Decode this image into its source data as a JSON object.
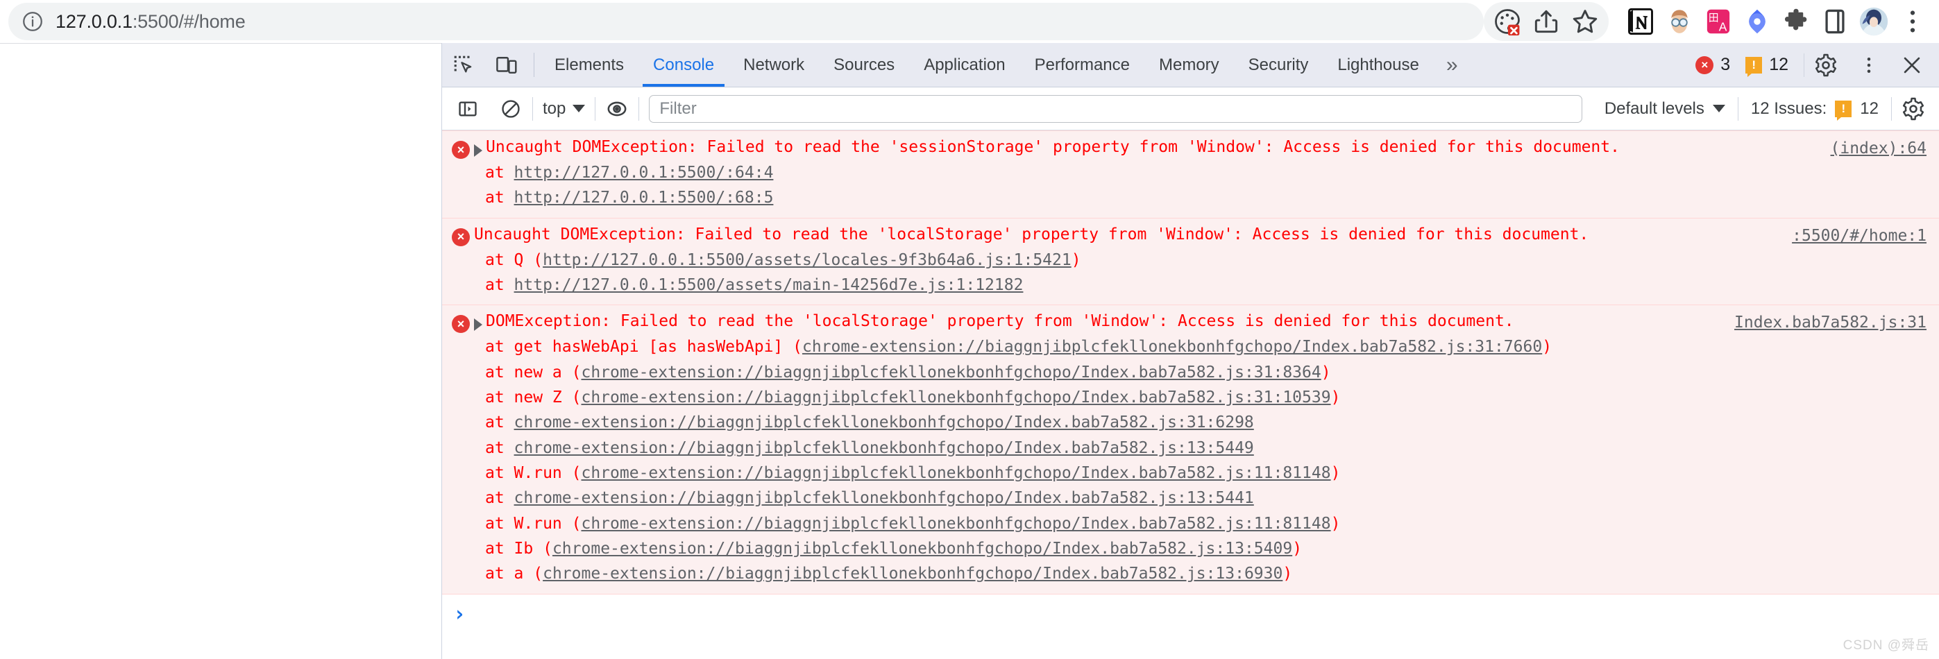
{
  "browser": {
    "site_info_icon": "info-circle-icon",
    "url_full": "127.0.0.1:5500/#/home",
    "url_host": "127.0.0.1",
    "url_rest": ":5500/#/home",
    "actions": [
      {
        "name": "color-picker-blocked-icon",
        "label": "Color picker blocked"
      },
      {
        "name": "share-icon",
        "label": "Share this page"
      },
      {
        "name": "bookmark-star-icon",
        "label": "Bookmark this tab"
      }
    ],
    "extensions": [
      {
        "name": "notion-extension-icon",
        "label": "Notion Web Clipper"
      },
      {
        "name": "avatar-sunglasses-extension-icon",
        "label": "Extension"
      },
      {
        "name": "translate-extension-icon",
        "label": "Translate"
      },
      {
        "name": "diamond-extension-icon",
        "label": "Extension"
      },
      {
        "name": "puzzle-extensions-icon",
        "label": "Extensions"
      },
      {
        "name": "side-panel-icon",
        "label": "Side panel"
      }
    ],
    "profile_avatar_label": "Profile",
    "more_menu_label": "Customize and control Google Chrome"
  },
  "devtools": {
    "inspect_icon_label": "Inspect element",
    "device_toolbar_icon_label": "Toggle device toolbar",
    "tabs": [
      {
        "label": "Elements",
        "active": false
      },
      {
        "label": "Console",
        "active": true
      },
      {
        "label": "Network",
        "active": false
      },
      {
        "label": "Sources",
        "active": false
      },
      {
        "label": "Application",
        "active": false
      },
      {
        "label": "Performance",
        "active": false
      },
      {
        "label": "Memory",
        "active": false
      },
      {
        "label": "Security",
        "active": false
      },
      {
        "label": "Lighthouse",
        "active": false
      }
    ],
    "overflow_label": "»",
    "error_count": "3",
    "warning_count": "12",
    "error_badge_glyph": "×",
    "warning_badge_glyph": "!",
    "settings_icon_label": "Settings",
    "more_options_icon_label": "More options",
    "close_icon_label": "Close DevTools"
  },
  "console_toolbar": {
    "sidebar_icon_label": "Show console sidebar",
    "clear_icon_label": "Clear console",
    "context_value": "top",
    "eye_icon_label": "Create live expression",
    "filter_placeholder": "Filter",
    "filter_value": "",
    "levels_value": "Default levels",
    "issues_label": "12 Issues:",
    "issues_count": "12",
    "settings_icon_label": "Console settings"
  },
  "console_messages": [
    {
      "level": "error",
      "expandable": true,
      "text": "Uncaught DOMException: Failed to read the 'sessionStorage' property from 'Window': Access is denied for this document.",
      "source": "(index):64",
      "stack": [
        {
          "prefix": "at ",
          "link": "http://127.0.0.1:5500/:64:4",
          "suffix": "",
          "open": "",
          "close": ""
        },
        {
          "prefix": "at ",
          "link": "http://127.0.0.1:5500/:68:5",
          "suffix": "",
          "open": "",
          "close": ""
        }
      ]
    },
    {
      "level": "error",
      "expandable": false,
      "text": "Uncaught DOMException: Failed to read the 'localStorage' property from 'Window': Access is denied for this document.",
      "source": ":5500/#/home:1",
      "stack": [
        {
          "prefix": "at Q ",
          "open": "(",
          "link": "http://127.0.0.1:5500/assets/locales-9f3b64a6.js:1:5421",
          "close": ")"
        },
        {
          "prefix": "at ",
          "open": "",
          "link": "http://127.0.0.1:5500/assets/main-14256d7e.js:1:12182",
          "close": ""
        }
      ]
    },
    {
      "level": "error",
      "expandable": true,
      "text": "DOMException: Failed to read the 'localStorage' property from 'Window': Access is denied for this document.",
      "source": "Index.bab7a582.js:31",
      "stack": [
        {
          "prefix": "at get hasWebApi [as hasWebApi] ",
          "open": "(",
          "link": "chrome-extension://biaggnjibplcfekllonekbonhfgchopo/Index.bab7a582.js:31:7660",
          "close": ")"
        },
        {
          "prefix": "at new a ",
          "open": "(",
          "link": "chrome-extension://biaggnjibplcfekllonekbonhfgchopo/Index.bab7a582.js:31:8364",
          "close": ")"
        },
        {
          "prefix": "at new Z ",
          "open": "(",
          "link": "chrome-extension://biaggnjibplcfekllonekbonhfgchopo/Index.bab7a582.js:31:10539",
          "close": ")"
        },
        {
          "prefix": "at ",
          "open": "",
          "link": "chrome-extension://biaggnjibplcfekllonekbonhfgchopo/Index.bab7a582.js:31:6298",
          "close": ""
        },
        {
          "prefix": "at ",
          "open": "",
          "link": "chrome-extension://biaggnjibplcfekllonekbonhfgchopo/Index.bab7a582.js:13:5449",
          "close": ""
        },
        {
          "prefix": "at W.run ",
          "open": "(",
          "link": "chrome-extension://biaggnjibplcfekllonekbonhfgchopo/Index.bab7a582.js:11:81148",
          "close": ")"
        },
        {
          "prefix": "at ",
          "open": "",
          "link": "chrome-extension://biaggnjibplcfekllonekbonhfgchopo/Index.bab7a582.js:13:5441",
          "close": ""
        },
        {
          "prefix": "at W.run ",
          "open": "(",
          "link": "chrome-extension://biaggnjibplcfekllonekbonhfgchopo/Index.bab7a582.js:11:81148",
          "close": ")"
        },
        {
          "prefix": "at Ib ",
          "open": "(",
          "link": "chrome-extension://biaggnjibplcfekllonekbonhfgchopo/Index.bab7a582.js:13:5409",
          "close": ")"
        },
        {
          "prefix": "at a ",
          "open": "(",
          "link": "chrome-extension://biaggnjibplcfekllonekbonhfgchopo/Index.bab7a582.js:13:6930",
          "close": ")"
        }
      ]
    }
  ],
  "console_prompt": {
    "chevron": "›"
  },
  "watermark": {
    "text": "CSDN @舜岳"
  },
  "colors": {
    "accent_blue": "#1a73e8",
    "error_red": "#ff0000",
    "error_bg": "#fcf0f0",
    "error_icon": "#e53935",
    "warning_orange": "#f5a623",
    "devtools_tabbar_bg": "#e8eaf2",
    "link_gray": "#5f6368"
  }
}
